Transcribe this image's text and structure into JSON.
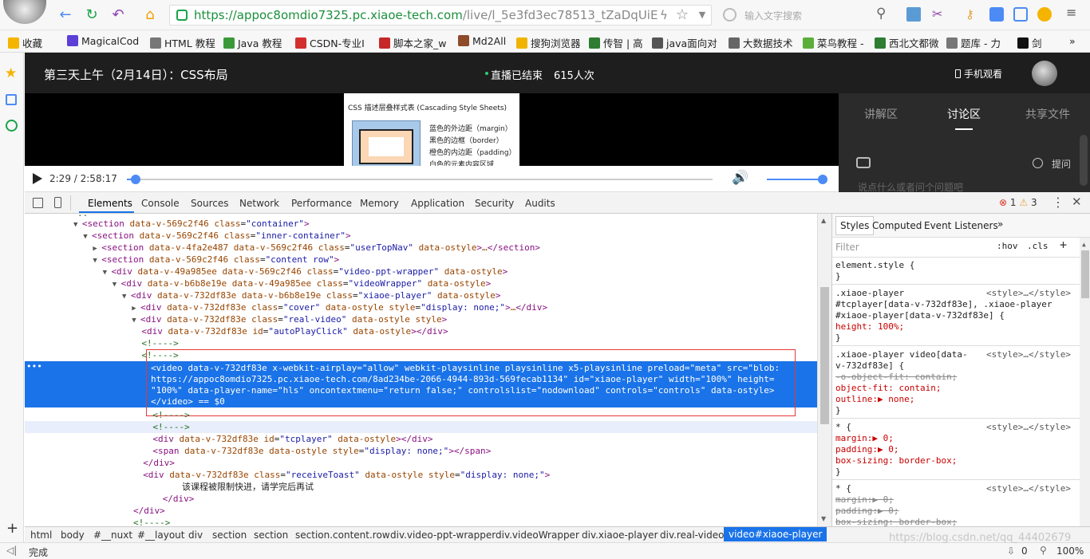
{
  "browser": {
    "url_host": "https://appoc8omdio7325.pc.xiaoe-tech.com",
    "url_path": "/live/l_5e3fd3ec78513_tZaDqUiE",
    "search_placeholder": "输入文字搜索",
    "status_text": "完成",
    "zoom": "100%",
    "download_count": "0"
  },
  "bookmarks": [
    {
      "label": "收藏",
      "color": "#f5b400"
    },
    {
      "label": "MagicalCod",
      "color": "#5b3fd6"
    },
    {
      "label": "HTML 教程",
      "color": "#777777"
    },
    {
      "label": "Java 教程",
      "color": "#3a9a3a"
    },
    {
      "label": "CSDN-专业I",
      "color": "#d32f2f"
    },
    {
      "label": "脚本之家_w",
      "color": "#c62828"
    },
    {
      "label": "Md2All",
      "color": "#8d4b2a"
    },
    {
      "label": "搜狗浏览器",
      "color": "#f0b400"
    },
    {
      "label": "传智 | 高",
      "color": "#2e7d32"
    },
    {
      "label": "java面向对",
      "color": "#555555"
    },
    {
      "label": "大数据技术",
      "color": "#666666"
    },
    {
      "label": "菜鸟教程 -",
      "color": "#5cae3b"
    },
    {
      "label": "西北文都微",
      "color": "#2e7d32"
    },
    {
      "label": "题库 - 力",
      "color": "#777777"
    },
    {
      "label": "剑",
      "color": "#111111"
    }
  ],
  "live": {
    "title": "第三天上午（2月14日）：CSS布局",
    "status": "直播已结束",
    "viewers": "615人次",
    "mobile_watch": "手机观看",
    "time_current": "2:29",
    "time_total": "2:58:17",
    "progress": 0.015,
    "volume": 1.0,
    "tabs": [
      "讲解区",
      "讨论区",
      "共享文件"
    ],
    "active_tab": "讨论区",
    "ask_label": "提问",
    "comment_placeholder": "说点什么或者问个问题吧",
    "slide_title": "CSS 描述层叠样式表 (Cascading Style Sheets)",
    "slide_lines": [
      "蓝色的外边距（margin）",
      "黑色的边框（border）",
      "橙色的内边距（padding）",
      "白色的元素内容区域"
    ]
  },
  "devtools": {
    "tabs": [
      "Elements",
      "Console",
      "Sources",
      "Network",
      "Performance",
      "Memory",
      "Application",
      "Security",
      "Audits"
    ],
    "active_tab": "Elements",
    "errors": "1",
    "warnings": "3",
    "dom_lines": [
      {
        "indent": 5,
        "arrow": "▼",
        "html": "<section data-v-569c2f46 class=\"container\">"
      },
      {
        "indent": 6,
        "arrow": "▼",
        "html": "<section data-v-569c2f46 class=\"inner-container\">"
      },
      {
        "indent": 7,
        "arrow": "▶",
        "html": "<section data-v-4fa2e487 data-v-569c2f46 class=\"userTopNav\" data-ostyle>…</section>"
      },
      {
        "indent": 7,
        "arrow": "▼",
        "html": "<section data-v-569c2f46 class=\"content row\">"
      },
      {
        "indent": 8,
        "arrow": "▼",
        "html": "<div data-v-49a985ee data-v-569c2f46 class=\"video-ppt-wrapper\" data-ostyle>"
      },
      {
        "indent": 9,
        "arrow": "▼",
        "html": "<div data-v-b6b8e19e data-v-49a985ee class=\"videoWrapper\" data-ostyle>"
      },
      {
        "indent": 10,
        "arrow": "▼",
        "html": "<div data-v-732df83e data-v-b6b8e19e class=\"xiaoe-player\" data-ostyle>"
      },
      {
        "indent": 11,
        "arrow": "▶",
        "html": "<div data-v-732df83e class=\"cover\" data-ostyle style=\"display: none;\">…</div>"
      },
      {
        "indent": 11,
        "arrow": "▼",
        "html": "<div data-v-732df83e class=\"real-video\" data-ostyle style>"
      },
      {
        "indent": 12,
        "arrow": "",
        "html": "<div data-v-732df83e id=\"autoPlayClick\" data-ostyle></div>"
      },
      {
        "indent": 12,
        "arrow": "",
        "html": "<!---->"
      },
      {
        "indent": 12,
        "arrow": "",
        "html": "<!---->"
      }
    ],
    "selected_lines": [
      "<video data-v-732df83e x-webkit-airplay=\"allow\" webkit-playsinline playsinline x5-playsinline preload=\"meta\" src=\"blob:",
      "https://appoc8omdio7325.pc.xiaoe-tech.com/8ad234be-2066-4944-893d-569fecab1134\" id=\"xiaoe-player\" width=\"100%\" height=",
      "\"100%\" data-player-name=\"hls\" oncontextmenu=\"return false;\" controlslist=\"nodownload\" controls=\"controls\" data-ostyle>",
      "</video> == $0"
    ],
    "dom_lines_after": [
      {
        "indent": 12,
        "html": "<!---->"
      },
      {
        "indent": 12,
        "html": "<!---->"
      },
      {
        "indent": 12,
        "html": "<div data-v-732df83e id=\"tcplayer\" data-ostyle></div>"
      },
      {
        "indent": 12,
        "html": "<span data-v-732df83e data-ostyle style=\"display: none;\"></span>"
      },
      {
        "indent": 11,
        "html": "</div>"
      },
      {
        "indent": 11,
        "html": "<div data-v-732df83e class=\"receiveToast\" data-ostyle style=\"display: none;\">"
      },
      {
        "indent": 15,
        "html": "该课程被限制快进，请学完后再试"
      },
      {
        "indent": 13,
        "html": "</div>"
      },
      {
        "indent": 10,
        "html": "</div>"
      },
      {
        "indent": 10,
        "html": "<!---->"
      }
    ],
    "styles_tabs": [
      "Styles",
      "Computed",
      "Event Listeners",
      "»"
    ],
    "filter_placeholder": "Filter",
    "hov": ":hov",
    "cls": ".cls",
    "styles": [
      {
        "text": "element.style {",
        "kind": "sel"
      },
      {
        "text": "}",
        "kind": "sel"
      },
      {
        "text": ".xiaoe-player",
        "kind": "sel",
        "src": "<style>…</style>"
      },
      {
        "text": "#tcplayer[data-v-732df83e], .xiaoe-player",
        "kind": "sel"
      },
      {
        "text": "#xiaoe-player[data-v-732df83e] {",
        "kind": "sel"
      },
      {
        "text": "  height: 100%;",
        "kind": "prop"
      },
      {
        "text": "}",
        "kind": "sel"
      },
      {
        "text": ".xiaoe-player video[data-",
        "kind": "sel",
        "src": "<style>…</style>"
      },
      {
        "text": "v-732df83e] {",
        "kind": "sel"
      },
      {
        "text": "  -o-object-fit: contain;",
        "kind": "strike"
      },
      {
        "text": "  object-fit: contain;",
        "kind": "prop"
      },
      {
        "text": "  outline:▶ none;",
        "kind": "prop"
      },
      {
        "text": "}",
        "kind": "sel"
      },
      {
        "text": "* {",
        "kind": "sel",
        "src": "<style>…</style>"
      },
      {
        "text": "  margin:▶ 0;",
        "kind": "prop"
      },
      {
        "text": "  padding:▶ 0;",
        "kind": "prop"
      },
      {
        "text": "  box-sizing: border-box;",
        "kind": "prop"
      },
      {
        "text": "}",
        "kind": "sel"
      },
      {
        "text": "* {",
        "kind": "sel",
        "src": "<style>…</style>"
      },
      {
        "text": "  margin:▶ 0;",
        "kind": "strike"
      },
      {
        "text": "  padding:▶ 0;",
        "kind": "strike"
      },
      {
        "text": "  box-sizing: border-box;",
        "kind": "strike"
      }
    ],
    "breadcrumbs": [
      "html",
      "body",
      "#__nuxt",
      "#__layout",
      "div",
      "section",
      "section",
      "section.content.row",
      "div.video-ppt-wrapper",
      "div.videoWrapper",
      "div.xiaoe-player",
      "div.real-video",
      "video#xiaoe-player"
    ]
  },
  "watermark": "https://blog.csdn.net/qq_44402679"
}
